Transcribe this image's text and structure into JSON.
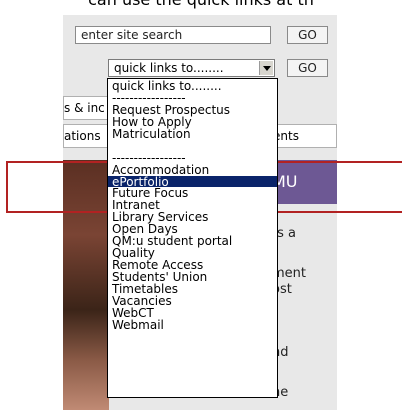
{
  "caption": "can use the quick links at th",
  "search": {
    "placeholder": "enter site search",
    "go_label": "GO"
  },
  "quicklinks": {
    "selected": "quick links to........",
    "go_label": "GO"
  },
  "nav": {
    "row1": "s & inc",
    "row2_left": "ations",
    "row2_right": "ents"
  },
  "banner": {
    "text": "MU"
  },
  "side_text": [
    "ts a",
    "ment",
    "ost",
    "nd",
    "he"
  ],
  "dropdown": {
    "options": [
      "quick links to........",
      "-----------------",
      "Request Prospectus",
      "How to Apply",
      "Matriculation",
      "",
      "-----------------",
      "Accommodation",
      "ePortfolio",
      "Future Focus",
      "Intranet",
      "Library Services",
      "Open Days",
      "QM:u student portal",
      "Quality",
      "Remote Access",
      "Students' Union",
      "Timetables",
      "Vacancies",
      "WebCT",
      "Webmail"
    ],
    "highlighted": "ePortfolio"
  }
}
